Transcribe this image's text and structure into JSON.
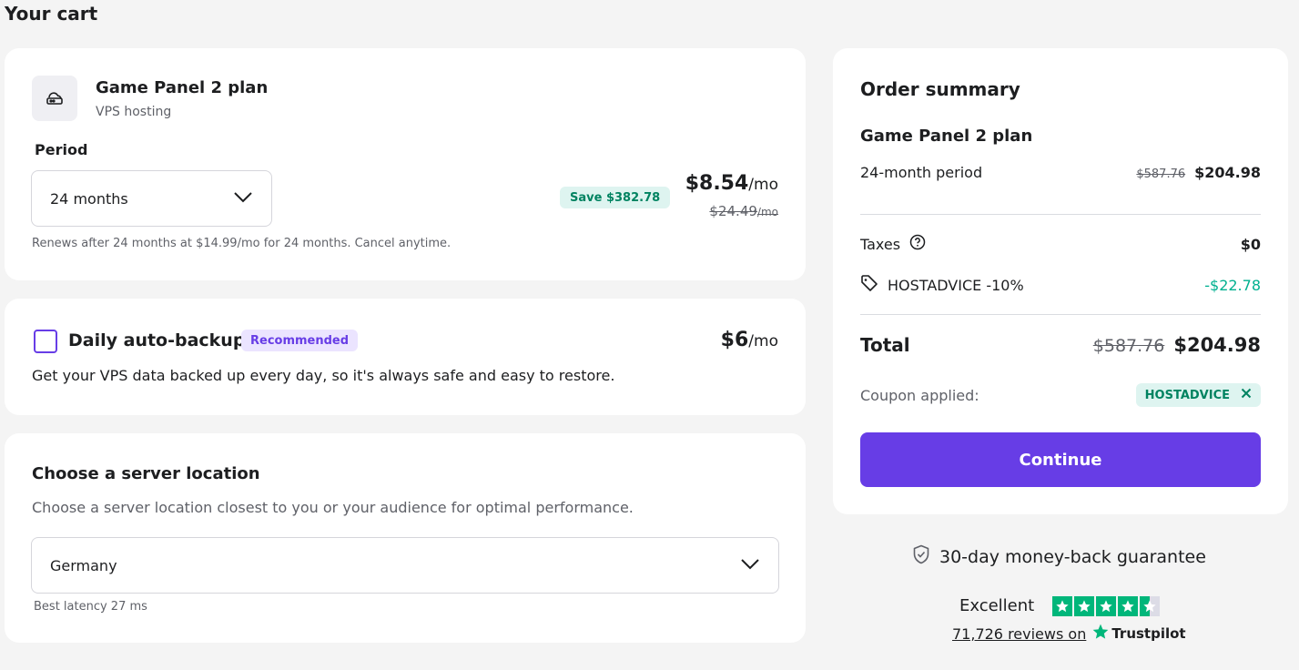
{
  "page": {
    "title": "Your cart"
  },
  "plan": {
    "icon": "cloud-server-icon",
    "title": "Game Panel 2 plan",
    "subtitle": "VPS hosting",
    "period_label": "Period",
    "period_value": "24 months",
    "renew_note": "Renews after 24 months at $14.99/mo for 24 months. Cancel anytime.",
    "save_badge": "Save $382.78",
    "price": "$8.54",
    "price_unit": "/mo",
    "old_price": "$24.49",
    "old_price_unit": "/mo"
  },
  "backup": {
    "title": "Daily auto-backup",
    "badge": "Recommended",
    "price": "$6",
    "price_unit": "/mo",
    "description": "Get your VPS data backed up every day, so it's always safe and easy to restore.",
    "checked": false
  },
  "location": {
    "title": "Choose a server location",
    "description": "Choose a server location closest to you or your audience for optimal performance.",
    "selected": "Germany",
    "latency": "Best latency 27 ms"
  },
  "summary": {
    "title": "Order summary",
    "plan_name": "Game Panel 2 plan",
    "period_label": "24-month period",
    "period_old_price": "$587.76",
    "period_price": "$204.98",
    "taxes_label": "Taxes",
    "taxes_value": "$0",
    "discount_label": "HOSTADVICE -10%",
    "discount_value": "-$22.78",
    "total_label": "Total",
    "total_old": "$587.76",
    "total_value": "$204.98",
    "coupon_label": "Coupon applied:",
    "coupon_code": "HOSTADVICE",
    "continue_label": "Continue"
  },
  "guarantee": {
    "text": "30-day money-back guarantee"
  },
  "trustpilot": {
    "rating_label": "Excellent",
    "stars": 4.5,
    "reviews_text": "71,726 reviews on",
    "brand": "Trustpilot"
  },
  "colors": {
    "accent": "#673de6",
    "success": "#00b090",
    "trustpilot_green": "#00b67a",
    "background": "#f4f4f4"
  }
}
